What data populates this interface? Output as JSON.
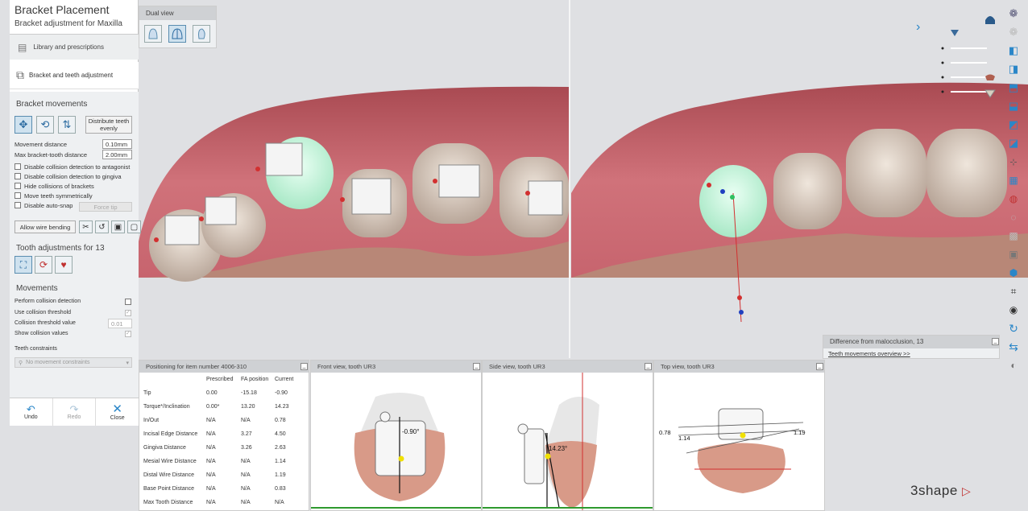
{
  "app": {
    "title": "Bracket Placement",
    "subtitle": "Bracket adjustment for Maxilla",
    "brand": "3shape"
  },
  "steps": [
    {
      "label": "Library and prescriptions"
    },
    {
      "label": "Bracket and teeth adjustment"
    }
  ],
  "bracket_movements": {
    "heading": "Bracket movements",
    "distribute_label": "Distribute teeth evenly",
    "movement_distance_label": "Movement distance",
    "movement_distance_value": "0.10mm",
    "max_gap_label": "Max bracket-tooth distance",
    "max_gap_value": "2.00mm",
    "checkboxes": [
      {
        "label": "Disable collision detection to antagonist"
      },
      {
        "label": "Disable collision detection to gingiva"
      },
      {
        "label": "Hide collisions of brackets"
      },
      {
        "label": "Move teeth symmetrically"
      },
      {
        "label": "Disable auto-snap"
      }
    ],
    "force_tip_label": "Force tip",
    "allow_wire_label": "Allow wire bending"
  },
  "tooth_adjustments": {
    "heading": "Tooth adjustments for 13"
  },
  "movements": {
    "heading": "Movements",
    "perform_collision": "Perform collision detection",
    "use_threshold": "Use collision threshold",
    "threshold_value_label": "Collision threshold value",
    "threshold_value": "0.01",
    "show_values": "Show collision values",
    "constraints_label": "Teeth constraints",
    "constraints_value": "No movement constraints"
  },
  "footer": {
    "undo": "Undo",
    "redo": "Redo",
    "close": "Close"
  },
  "dual_view": {
    "label": "Dual view"
  },
  "positioning": {
    "title": "Positioning for item number 4006-310",
    "columns": [
      "",
      "Prescribed",
      "FA position",
      "Current"
    ],
    "rows": [
      [
        "Tip",
        "0.00",
        "-15.18",
        "-0.90"
      ],
      [
        "Torque*/Inclination",
        "0.00*",
        "13.20",
        "14.23"
      ],
      [
        "In/Out",
        "N/A",
        "N/A",
        "0.78"
      ],
      [
        "Incisal Edge Distance",
        "N/A",
        "3.27",
        "4.50"
      ],
      [
        "Gingiva Distance",
        "N/A",
        "3.26",
        "2.63"
      ],
      [
        "Mesial Wire Distance",
        "N/A",
        "N/A",
        "1.14"
      ],
      [
        "Distal Wire Distance",
        "N/A",
        "N/A",
        "1.19"
      ],
      [
        "Base Point Distance",
        "N/A",
        "N/A",
        "0.83"
      ],
      [
        "Max Tooth Distance",
        "N/A",
        "N/A",
        "N/A"
      ]
    ]
  },
  "front_view": {
    "title": "Front view, tooth UR3",
    "angle": "-0.90°"
  },
  "side_view": {
    "title": "Side view, tooth UR3",
    "angle": "14.23°"
  },
  "top_view": {
    "title": "Top view, tooth UR3",
    "left": "0.78",
    "mid": "1.14",
    "right": "1.19"
  },
  "malocclusion": {
    "title": "Difference from malocclusion, 13",
    "link": "Teeth movements overview >>"
  },
  "colors": {
    "accent": "#2a86c8",
    "gingiva": "#c9626c",
    "selected_tooth": "#bff0d8",
    "wire_green": "#2e9a2e",
    "axis_red": "#d23030"
  }
}
